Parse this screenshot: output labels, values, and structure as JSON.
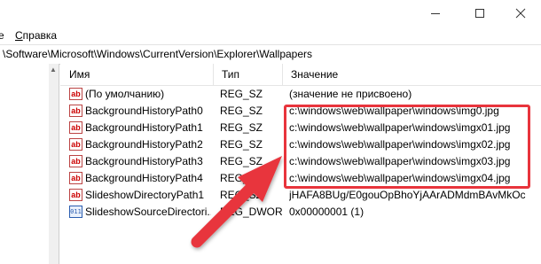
{
  "window": {
    "minimize_icon": "minimize-icon",
    "maximize_icon": "maximize-icon",
    "close_icon": "close-icon"
  },
  "menubar": {
    "items": [
      {
        "label": "е",
        "underline": ""
      },
      {
        "label": "правка",
        "underline": "С"
      }
    ]
  },
  "address": {
    "path": "\\Software\\Microsoft\\Windows\\CurrentVersion\\Explorer\\Wallpapers"
  },
  "columns": {
    "name": "Имя",
    "type": "Тип",
    "value": "Значение"
  },
  "rows": [
    {
      "icon": "string-value-icon",
      "name": "(По умолчанию)",
      "type": "REG_SZ",
      "value": "(значение не присвоено)"
    },
    {
      "icon": "string-value-icon",
      "name": "BackgroundHistoryPath0",
      "type": "REG_SZ",
      "value": "c:\\windows\\web\\wallpaper\\windows\\img0.jpg"
    },
    {
      "icon": "string-value-icon",
      "name": "BackgroundHistoryPath1",
      "type": "REG_SZ",
      "value": "c:\\windows\\web\\wallpaper\\windows\\imgx01.jpg"
    },
    {
      "icon": "string-value-icon",
      "name": "BackgroundHistoryPath2",
      "type": "REG_SZ",
      "value": "c:\\windows\\web\\wallpaper\\windows\\imgx02.jpg"
    },
    {
      "icon": "string-value-icon",
      "name": "BackgroundHistoryPath3",
      "type": "REG_SZ",
      "value": "c:\\windows\\web\\wallpaper\\windows\\imgx03.jpg"
    },
    {
      "icon": "string-value-icon",
      "name": "BackgroundHistoryPath4",
      "type": "REG_SZ",
      "value": "c:\\windows\\web\\wallpaper\\windows\\imgx04.jpg"
    },
    {
      "icon": "string-value-icon",
      "name": "SlideshowDirectoryPath1",
      "type": "REG_SZ",
      "value": "jHAFA8BUg/E0gouOpBhoYjAArADMdmBAvMkOc"
    },
    {
      "icon": "dword-value-icon",
      "name": "SlideshowSourceDirectori...",
      "type": "REG_DWORD",
      "value": "0x00000001 (1)"
    }
  ],
  "annotation": {
    "highlight_color": "#e8343c"
  }
}
